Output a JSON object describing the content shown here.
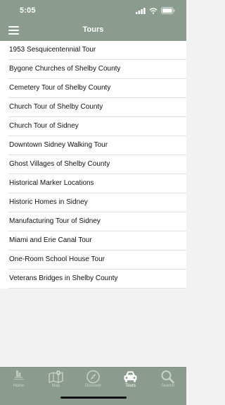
{
  "status": {
    "time": "5:05"
  },
  "header": {
    "title": "Tours"
  },
  "tours": [
    {
      "label": "1953 Sesquicentennial Tour"
    },
    {
      "label": "Bygone Churches of Shelby County"
    },
    {
      "label": "Cemetery Tour of Shelby County"
    },
    {
      "label": "Church Tour of Shelby County"
    },
    {
      "label": "Church Tour of Sidney"
    },
    {
      "label": "Downtown Sidney Walking Tour"
    },
    {
      "label": "Ghost Villages of Shelby County"
    },
    {
      "label": "Historical Marker Locations"
    },
    {
      "label": "Historic Homes in Sidney"
    },
    {
      "label": "Manufacturing Tour of Sidney"
    },
    {
      "label": "Miami and Erie Canal Tour"
    },
    {
      "label": "One-Room School House Tour"
    },
    {
      "label": "Veterans Bridges in Shelby County"
    }
  ],
  "tabbar": {
    "tabs": [
      {
        "label": "Home",
        "icon": "home-logo-icon",
        "active": false
      },
      {
        "label": "Map",
        "icon": "map-icon",
        "active": false
      },
      {
        "label": "Discover",
        "icon": "compass-icon",
        "active": false
      },
      {
        "label": "Tours",
        "icon": "car-icon",
        "active": true
      },
      {
        "label": "Search",
        "icon": "search-icon",
        "active": false
      }
    ]
  },
  "colors": {
    "bar": "#8b9c8e",
    "inactive_tab": "#c9d2ca",
    "active_tab": "#ffffff",
    "background": "#f2f2f2"
  }
}
